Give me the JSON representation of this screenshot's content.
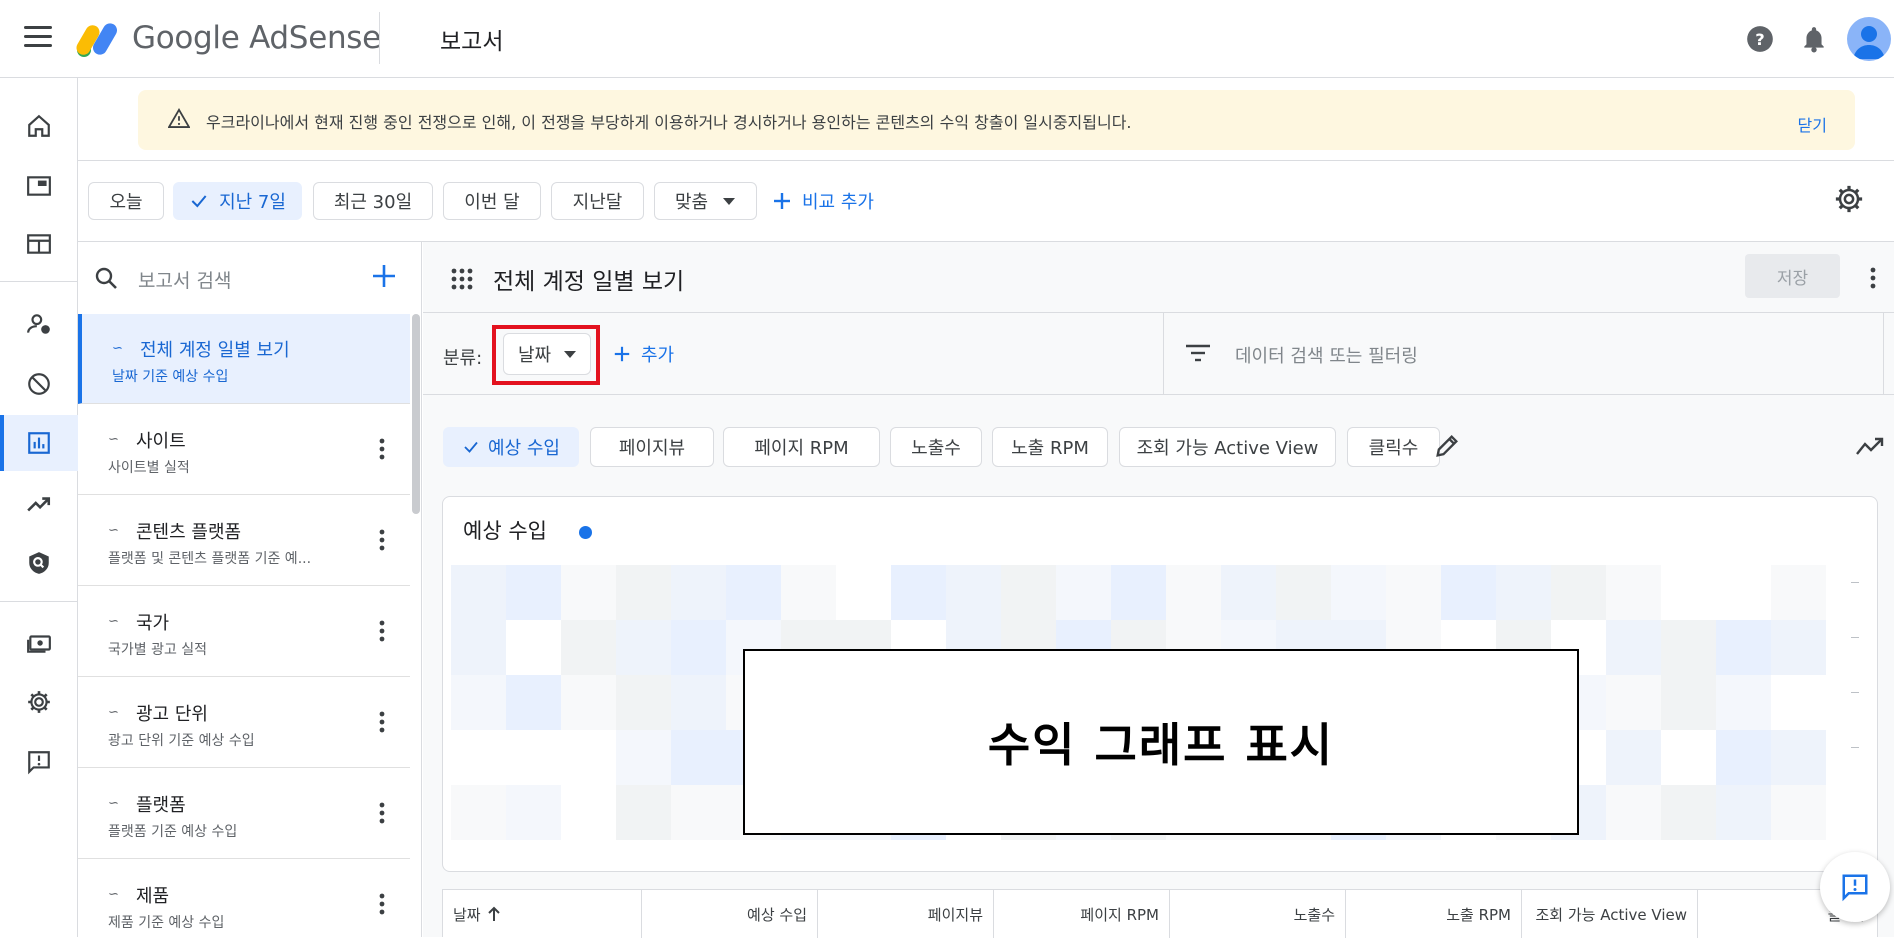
{
  "app": {
    "brand": "Google AdSense",
    "page_title": "보고서"
  },
  "banner": {
    "message": "우크라이나에서 현재 진행 중인 전쟁으로 인해, 이 전쟁을 부당하게 이용하거나 경시하거나 용인하는 콘텐츠의 수익 창출이 일시중지됩니다.",
    "close_label": "닫기"
  },
  "date_filters": {
    "chips": [
      "오늘",
      "지난 7일",
      "최근 30일",
      "이번 달",
      "지난달",
      "맞춤"
    ],
    "selected": "지난 7일",
    "add_compare": "비교 추가"
  },
  "reports_panel": {
    "search_placeholder": "보고서 검색",
    "items": [
      {
        "title": "전체 계정 일별 보기",
        "subtitle": "날짜 기준 예상 수입"
      },
      {
        "title": "사이트",
        "subtitle": "사이트별 실적"
      },
      {
        "title": "콘텐츠 플랫폼",
        "subtitle": "플랫폼 및 콘텐츠 플랫폼 기준 예..."
      },
      {
        "title": "국가",
        "subtitle": "국가별 광고 실적"
      },
      {
        "title": "광고 단위",
        "subtitle": "광고 단위 기준 예상 수입"
      },
      {
        "title": "플랫폼",
        "subtitle": "플랫폼 기준 예상 수입"
      },
      {
        "title": "제품",
        "subtitle": "제품 기준 예상 수입"
      }
    ]
  },
  "report": {
    "title": "전체 계정 일별 보기",
    "save_label": "저장",
    "breakdown_label": "분류:",
    "breakdown_value": "날짜",
    "add_label": "추가",
    "filter_placeholder": "데이터 검색 또는 필터링"
  },
  "metrics": {
    "chips": [
      "예상 수입",
      "페이지뷰",
      "페이지 RPM",
      "노출수",
      "노출 RPM",
      "조회 가능 Active View",
      "클릭수"
    ],
    "selected": "예상 수입"
  },
  "chart": {
    "title": "예상 수입",
    "overlay_text": "수익 그래프 표시",
    "series_color": "#1a73e8"
  },
  "table": {
    "columns": [
      "날짜",
      "예상 수입",
      "페이지뷰",
      "페이지 RPM",
      "노출수",
      "노출 RPM",
      "조회 가능 Active View",
      "클릭수"
    ]
  },
  "colors": {
    "accent": "#1a73e8",
    "banner_bg": "#fef7e0",
    "highlight_box": "#e3121f"
  },
  "icons": {
    "top": [
      "menu-icon",
      "adsense-logo",
      "help-icon",
      "bell-icon",
      "account-avatar"
    ],
    "nav": [
      "home-icon",
      "ads-icon",
      "sites-icon",
      "account-access-icon",
      "block-icon",
      "reports-icon",
      "optimization-icon",
      "privacy-icon",
      "payments-icon",
      "settings-icon",
      "feedback-icon"
    ]
  }
}
